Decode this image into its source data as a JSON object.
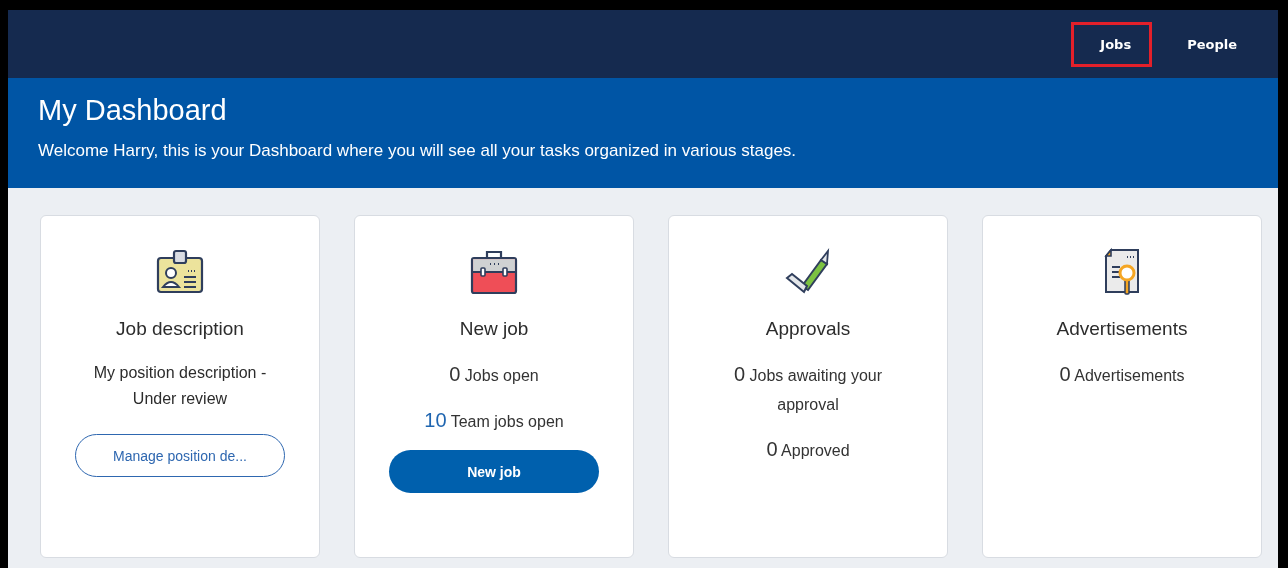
{
  "nav": {
    "items": [
      {
        "label": "Jobs",
        "highlighted": true
      },
      {
        "label": "People",
        "highlighted": false
      }
    ]
  },
  "header": {
    "title": "My Dashboard",
    "subtitle": "Welcome Harry, this is your Dashboard where you will see all your tasks organized in various stages."
  },
  "cards": [
    {
      "kind": "badge",
      "title": "Job description",
      "description": "My position description - Under review",
      "button": {
        "label": "Manage position de...",
        "kind": "outline"
      }
    },
    {
      "kind": "toolbox",
      "title": "New job",
      "stats": [
        {
          "count": "0",
          "label": "Jobs open",
          "accent": false
        },
        {
          "count": "10",
          "label": "Team jobs open",
          "accent": true
        }
      ],
      "button": {
        "label": "New job",
        "kind": "filled"
      }
    },
    {
      "kind": "approval",
      "title": "Approvals",
      "stats": [
        {
          "count": "0",
          "label": "Jobs awaiting your approval",
          "accent": false
        },
        {
          "count": "0",
          "label": "Approved",
          "accent": false
        }
      ]
    },
    {
      "kind": "document",
      "title": "Advertisements",
      "stats": [
        {
          "count": "0",
          "label": "Advertisements",
          "accent": false
        }
      ]
    }
  ]
}
